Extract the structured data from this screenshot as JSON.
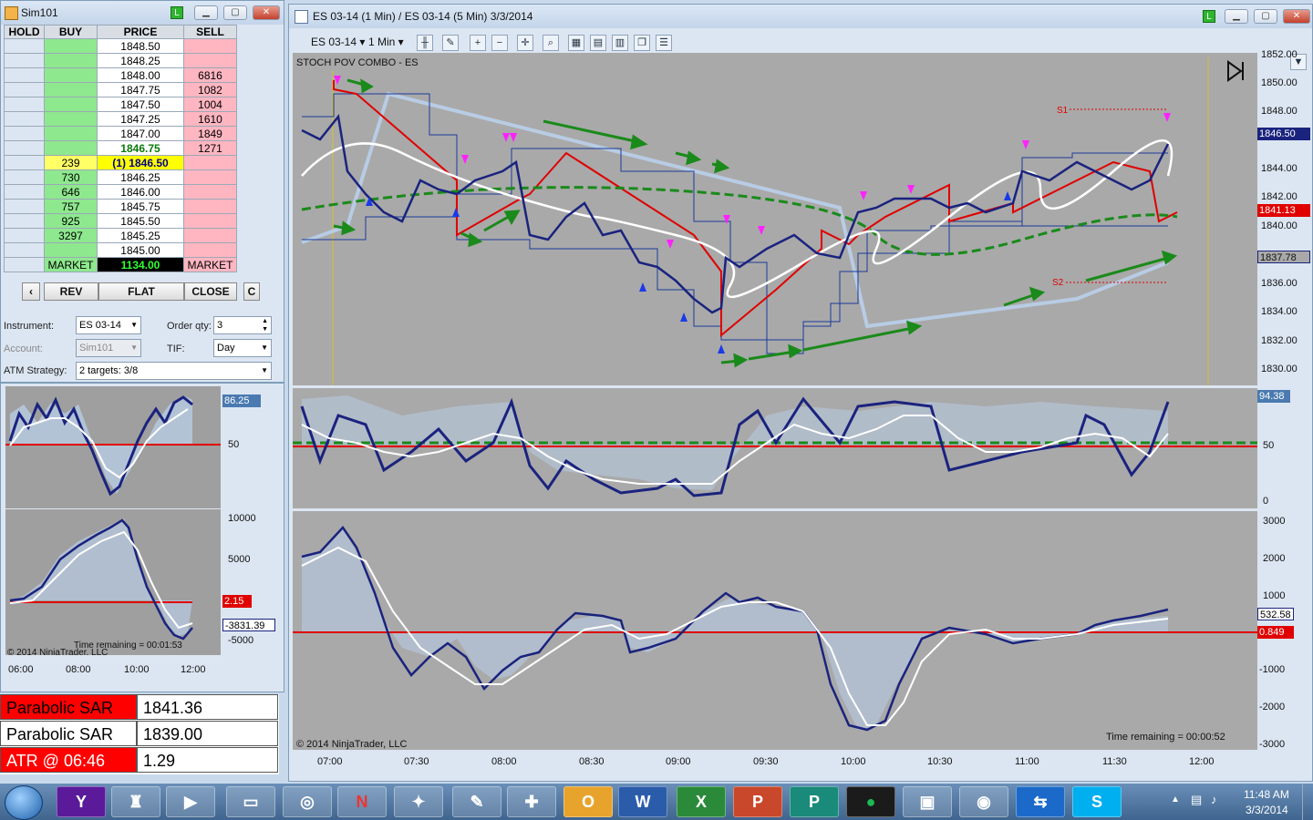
{
  "dom": {
    "title": "Sim101",
    "lbadge": "L",
    "headers": [
      "HOLD",
      "BUY",
      "PRICE",
      "SELL"
    ],
    "rows": [
      {
        "buy": "",
        "price": "1848.50",
        "sell": ""
      },
      {
        "buy": "",
        "price": "1848.25",
        "sell": ""
      },
      {
        "buy": "",
        "price": "1848.00",
        "sell": "6816"
      },
      {
        "buy": "",
        "price": "1847.75",
        "sell": "1082"
      },
      {
        "buy": "",
        "price": "1847.50",
        "sell": "1004"
      },
      {
        "buy": "",
        "price": "1847.25",
        "sell": "1610"
      },
      {
        "buy": "",
        "price": "1847.00",
        "sell": "1849"
      },
      {
        "buy": "",
        "price": "1846.75",
        "sell": "1271"
      },
      {
        "buy": "239",
        "price": "(1) 1846.50",
        "sell": ""
      },
      {
        "buy": "730",
        "price": "1846.25",
        "sell": ""
      },
      {
        "buy": "646",
        "price": "1846.00",
        "sell": ""
      },
      {
        "buy": "757",
        "price": "1845.75",
        "sell": ""
      },
      {
        "buy": "925",
        "price": "1845.50",
        "sell": ""
      },
      {
        "buy": "3297",
        "price": "1845.25",
        "sell": ""
      },
      {
        "buy": "",
        "price": "1845.00",
        "sell": ""
      }
    ],
    "market_buy": "MARKET",
    "market_price": "1134.00",
    "market_sell": "MARKET",
    "buttons": {
      "left": "‹",
      "rev": "REV",
      "flat": "FLAT",
      "close": "CLOSE",
      "c": "C"
    },
    "instrument_label": "Instrument:",
    "instrument": "ES 03-14",
    "orderqty_label": "Order qty:",
    "orderqty": "3",
    "account_label": "Account:",
    "account": "Sim101",
    "tif_label": "TIF:",
    "tif": "Day",
    "atm_label": "ATM Strategy:",
    "atm": "2 targets: 3/8"
  },
  "mini_chart": {
    "stoch_axis": [
      "50"
    ],
    "stoch_value": "86.25",
    "macd_axis": [
      "10000",
      "5000",
      "-5000"
    ],
    "macd_value_red": "2.15",
    "macd_value": "-3831.39",
    "time_remaining": "Time remaining = 00:01:53",
    "copyright": "© 2014 NinjaTrader, LLC",
    "time_ticks": [
      "06:00",
      "08:00",
      "10:00",
      "12:00"
    ]
  },
  "stats": [
    {
      "label": "Parabolic SAR",
      "value": "1841.36"
    },
    {
      "label": "Parabolic SAR",
      "value": "1839.00"
    },
    {
      "label": "ATR @ 06:46",
      "value": "1.29"
    }
  ],
  "chart": {
    "title": "ES 03-14 (1 Min) / ES 03-14 (5 Min)  3/3/2014",
    "lbadge": "L",
    "toolbar": {
      "instrument": "ES 03-14",
      "interval": "1 Min"
    },
    "indicator_label": "STOCH POV COMBO - ES",
    "price_ticks": [
      "1852.00",
      "1850.00",
      "1848.00",
      "1846.00",
      "1844.00",
      "1842.00",
      "1840.00",
      "1838.00",
      "1836.00",
      "1834.00",
      "1832.00",
      "1830.00"
    ],
    "last_price": "1846.50",
    "price_tag_red": "1841.13",
    "price_tag_gray": "1837.78",
    "s1": "S1",
    "s2": "S2",
    "stoch_ticks": [
      "50",
      "0"
    ],
    "stoch_value": "94.38",
    "macd_ticks": [
      "3000",
      "2000",
      "1000",
      "-1000",
      "-2000",
      "-3000"
    ],
    "macd_value": "532.58",
    "macd_value_red": "0.849",
    "copyright": "© 2014 NinjaTrader, LLC",
    "time_remaining": "Time remaining = 00:00:52",
    "time_ticks": [
      "07:00",
      "07:30",
      "08:00",
      "08:30",
      "09:00",
      "09:30",
      "10:00",
      "10:30",
      "11:00",
      "11:30",
      "12:00"
    ]
  },
  "taskbar": {
    "clock_time": "11:48 AM",
    "clock_date": "3/3/2014",
    "apps": [
      "start-orb",
      "yahoo",
      "game",
      "media-player",
      "file-explorer",
      "browser",
      "ninjatrader",
      "compass",
      "notes",
      "puzzle",
      "outlook",
      "word",
      "excel",
      "powerpoint",
      "publisher",
      "spotify",
      "archive",
      "chrome",
      "teamviewer",
      "skype"
    ]
  },
  "colors": {
    "buy_bg": "#8ee88e",
    "sell_bg": "#ffb6c1",
    "chart_bg": "#a9a9a9",
    "accent_red": "#e00000",
    "accent_green": "#1a8a1a",
    "line_navy": "#1a237e"
  }
}
